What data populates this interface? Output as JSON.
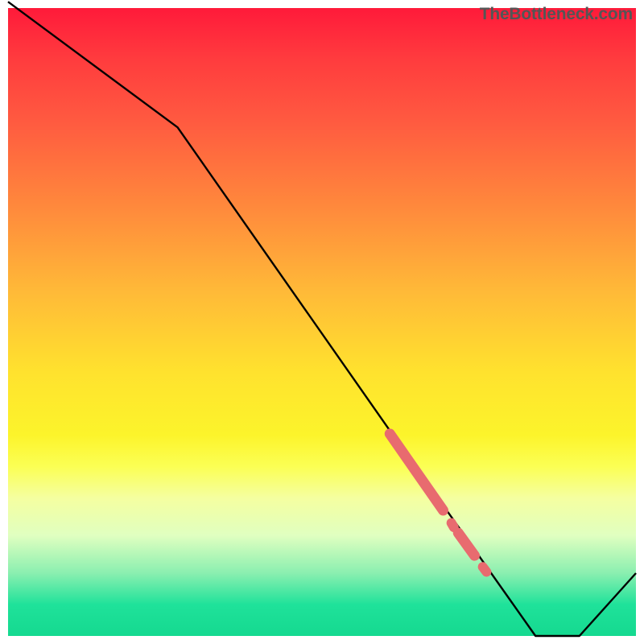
{
  "watermark": "TheBottleneck.com",
  "chart_data": {
    "type": "line",
    "title": "",
    "xlabel": "",
    "ylabel": "",
    "xlim": [
      0,
      100
    ],
    "ylim": [
      0,
      100
    ],
    "series": [
      {
        "name": "bottleneck-curve",
        "x": [
          0,
          27,
          62,
          72,
          84,
          91,
          100
        ],
        "values": [
          101,
          81,
          31,
          17,
          0,
          0,
          10
        ]
      }
    ],
    "highlight_segments": [
      {
        "x0": 60.8,
        "y0": 32.2,
        "x1": 69.3,
        "y1": 20.0,
        "thickness": "thick"
      },
      {
        "x0": 70.6,
        "y0": 18.0,
        "x1": 71.0,
        "y1": 17.3,
        "thickness": "dot"
      },
      {
        "x0": 71.7,
        "y0": 16.4,
        "x1": 74.3,
        "y1": 12.8,
        "thickness": "thick"
      },
      {
        "x0": 75.6,
        "y0": 11.0,
        "x1": 76.2,
        "y1": 10.2,
        "thickness": "dot"
      }
    ],
    "highlight_color": "#e86b6f"
  }
}
